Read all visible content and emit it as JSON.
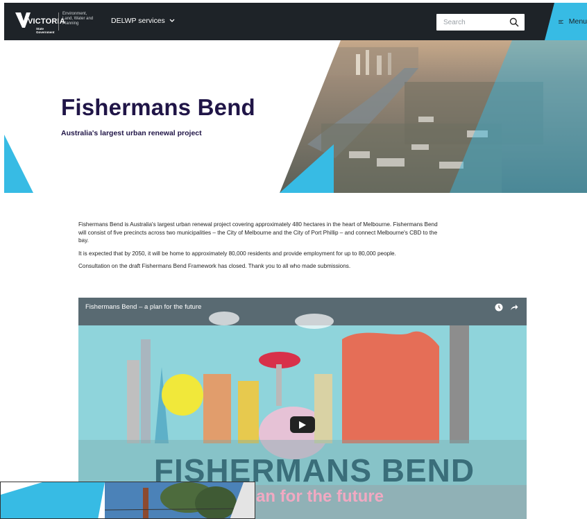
{
  "header": {
    "logo_text": "VICTORIA",
    "logo_sub": "State Government",
    "department": "Environment, Land, Water and Planning",
    "services_label": "DELWP services",
    "search_placeholder": "Search",
    "menu_label": "Menu"
  },
  "hero": {
    "title": "Fishermans Bend",
    "subtitle": "Australia's largest urban renewal project"
  },
  "content": {
    "paragraphs": [
      "Fishermans Bend is Australia's largest urban renewal project covering approximately 480 hectares in the heart of Melbourne. Fishermans Bend will consist of five precincts across two municipalities – the City of Melbourne and the City of Port Phillip – and connect Melbourne's CBD to the bay.",
      "It is expected that by 2050, it will be home to approximately 80,000 residents and provide employment for up to 80,000 people.",
      "Consultation on the draft Fishermans Bend Framework has closed. Thank you to all who made submissions."
    ]
  },
  "video": {
    "title": "Fishermans Bend – a plan for the future",
    "big_text": "FISHERMANS BEND",
    "sub_text": "an for the future"
  },
  "colors": {
    "header_bg": "#1e2328",
    "accent": "#37bbe4",
    "title": "#201547"
  }
}
